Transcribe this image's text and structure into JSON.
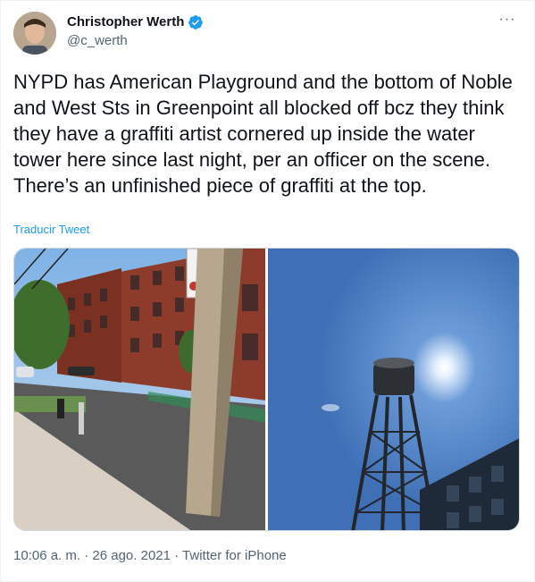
{
  "author": {
    "name": "Christopher Werth",
    "handle": "@c_werth"
  },
  "tweet": {
    "text": "NYPD has American Playground and the bottom of Noble and West Sts in Greenpoint all blocked off bcz they think they have a graffiti artist cornered up inside the water tower here since last night, per an officer on the scene. There’s an unfinished piece of graffiti at the top.",
    "translate_label": "Traducir Tweet"
  },
  "meta": {
    "time": "10:06 a. m.",
    "sep1": " · ",
    "date": "26 ago. 2021",
    "sep2": " · ",
    "source": "Twitter for iPhone"
  },
  "menu": {
    "more_label": "···"
  },
  "colors": {
    "accent": "#1d9bf0",
    "text": "#0f1419",
    "secondary": "#536471"
  },
  "icons": {
    "verified": "verified-badge-icon",
    "more": "more-icon"
  }
}
